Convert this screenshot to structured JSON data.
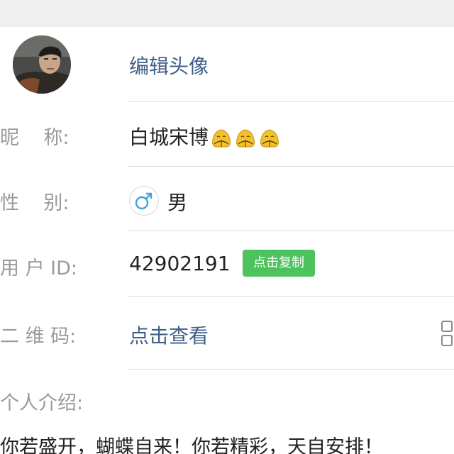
{
  "profile": {
    "edit_avatar_label": "编辑头像",
    "nickname": {
      "label": "昵    称:",
      "value": "白城宋博",
      "emoji_icon": "pray-hands-icon"
    },
    "gender": {
      "label": "性    别:",
      "icon": "male-icon",
      "value": "男"
    },
    "user_id": {
      "label": "用 户 ID:",
      "value": "42902191",
      "copy_label": "点击复制"
    },
    "qrcode": {
      "label": "二 维 码:",
      "link": "点击查看",
      "icon": "qr-code-icon"
    },
    "intro": {
      "label": "个人介绍:",
      "text": "你若盛开，蝴蝶自来！你若精彩，天自安排！"
    }
  },
  "colors": {
    "link": "#3f5f86",
    "copy_button": "#4cc35d",
    "label": "#9a9a9a",
    "male_icon": "#3aa6d8",
    "emoji": "#f2c12e"
  }
}
